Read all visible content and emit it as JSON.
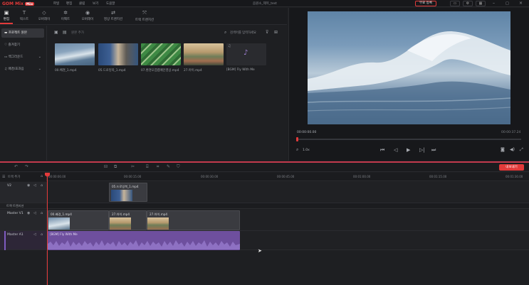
{
  "app": {
    "logo": "GOM Mix",
    "logo_badge": "Max",
    "menus": [
      "파일",
      "편집",
      "클립",
      "보기",
      "도움말"
    ],
    "project_title": "음원소_제목_test",
    "upgrade_label": "무료 등록"
  },
  "tool_tabs": [
    {
      "icon": "edit-icon",
      "label": "편집"
    },
    {
      "icon": "text-icon",
      "label": "텍스트"
    },
    {
      "icon": "overlay-icon",
      "label": "오버레이"
    },
    {
      "icon": "effect-icon",
      "label": "이펙트"
    },
    {
      "icon": "filter-icon",
      "label": "오버레이"
    },
    {
      "icon": "transition-icon",
      "label": "영상 트랜지션"
    },
    {
      "icon": "text-transition-icon",
      "label": "트랙 트랜지션"
    }
  ],
  "sidebar": {
    "items": [
      {
        "label": "프로젝트 원본",
        "icon": "folder-icon",
        "active": true
      },
      {
        "label": "즐겨찾기",
        "icon": "heart-icon",
        "active": false
      },
      {
        "label": "백그라운드",
        "icon": "image-icon",
        "active": false,
        "chevron": true
      },
      {
        "label": "배경/효과음",
        "icon": "music-icon",
        "active": false,
        "chevron": true
      }
    ]
  },
  "media": {
    "search_placeholder": "검색어를 입력하세요",
    "add_label": "원본 추가",
    "items": [
      {
        "label": "00.배경_1.mp4",
        "kind": "waves"
      },
      {
        "label": "05.드로잉북_1.mp4",
        "kind": "drawing"
      },
      {
        "label": "07.환경오염캠페인영상.mp4",
        "kind": "green"
      },
      {
        "label": "27.아이.mp4",
        "kind": "crowd"
      },
      {
        "label": "[BGM] Fly With Me",
        "kind": "audio"
      }
    ]
  },
  "preview": {
    "time_current": "00:00:00.00",
    "time_total": "00:00:37.24",
    "zoom": "1.0x"
  },
  "timeline": {
    "export_label": "내보내기",
    "track_header_label": "트랙 추가",
    "ruler": [
      "00:00:00.00",
      "00:00:15.00",
      "00:00:30.00",
      "00:00:45.00",
      "00:01:00.00",
      "00:01:15.00",
      "00:01:30.00"
    ],
    "tracks": {
      "v2": {
        "name": "V2",
        "clips": [
          "05.드로잉북_1.mp4"
        ]
      },
      "transition": {
        "name": "트랙 트랜지션"
      },
      "master_v1": {
        "name": "Master V1",
        "clips": [
          "00.배경_1.mp4",
          "27.아이.mp4",
          "27.아이.mp4"
        ]
      },
      "master_a1": {
        "name": "Master A1",
        "clips": [
          "[BGM] Fly With Me"
        ]
      }
    }
  },
  "colors": {
    "accent": "#e23a3a",
    "audio_clip": "#6e4f9e",
    "background": "#1e1f22"
  }
}
